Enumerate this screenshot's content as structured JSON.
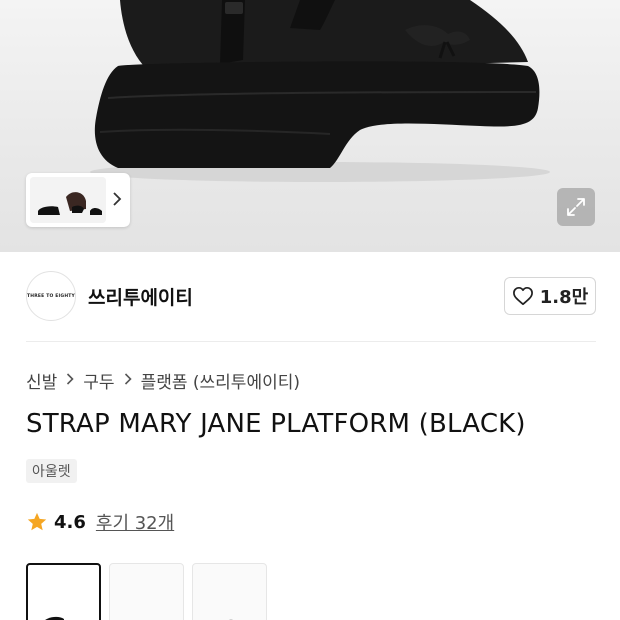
{
  "hero": {
    "expand_icon": "expand-icon",
    "thumb_next_icon": "chevron-right-icon"
  },
  "brand": {
    "logo_text": "THREE TO EIGHTY",
    "name": "쓰리투에이티",
    "like_icon": "heart-outline-icon",
    "like_count": "1.8만"
  },
  "breadcrumb": {
    "items": [
      "신발",
      "구두",
      "플랫폼 (쓰리투에이티)"
    ],
    "separator_icon": "chevron-right-icon"
  },
  "product": {
    "title": "STRAP MARY JANE PLATFORM (BLACK)",
    "tag": "아울렛"
  },
  "rating": {
    "star_icon": "star-icon",
    "star_color": "#f5a623",
    "score": "4.6",
    "reviews": "후기 32개"
  },
  "options": {
    "count": 3,
    "selected_index": 0
  }
}
